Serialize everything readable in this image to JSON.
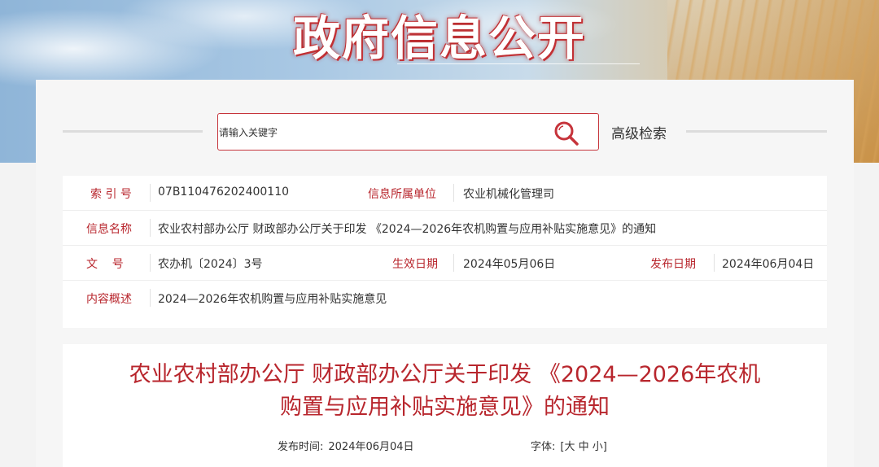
{
  "banner": {
    "title": "政府信息公开"
  },
  "search": {
    "placeholder": "请输入关键字",
    "advanced_label": "高级检索"
  },
  "info": {
    "index_no": {
      "label": "索 引 号",
      "value": "07B110476202400110"
    },
    "org": {
      "label": "信息所属单位",
      "value": "农业机械化管理司"
    },
    "name": {
      "label": "信息名称",
      "value": "农业农村部办公厅 财政部办公厅关于印发 《2024—2026年农机购置与应用补贴实施意见》的通知"
    },
    "doc_no": {
      "label": "文    号",
      "value": "农办机〔2024〕3号"
    },
    "effective": {
      "label": "生效日期",
      "value": "2024年05月06日"
    },
    "published": {
      "label": "发布日期",
      "value": "2024年06月04日"
    },
    "summary": {
      "label": "内容概述",
      "value": "2024—2026年农机购置与应用补贴实施意见"
    }
  },
  "article": {
    "title_line1": "农业农村部办公厅 财政部办公厅关于印发 《2024—2026年农机",
    "title_line2": "购置与应用补贴实施意见》的通知",
    "publish_label": "发布时间:",
    "publish_date": "2024年06月04日",
    "font_label": "字体:",
    "font_open": "[",
    "font_large": "大",
    "font_medium": "中",
    "font_small": "小",
    "font_close": "]"
  },
  "colors": {
    "accent": "#b8262d",
    "border": "#c6343b"
  },
  "icons": {
    "search": "search-icon"
  }
}
